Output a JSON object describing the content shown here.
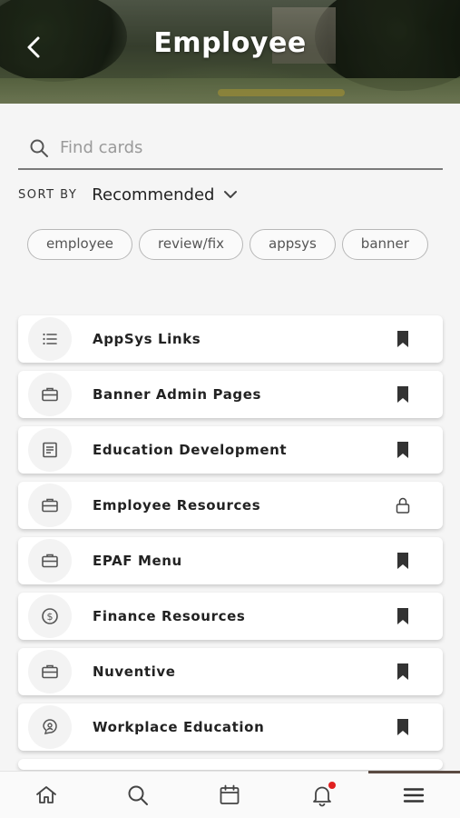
{
  "header": {
    "title": "Employee",
    "back_icon": "chevron-left-icon"
  },
  "search": {
    "placeholder": "Find cards",
    "value": "",
    "icon": "search-icon"
  },
  "sort": {
    "label": "SORT BY",
    "value": "Recommended",
    "icon": "chevron-down-icon"
  },
  "tags": [
    "employee",
    "review/fix",
    "appsys",
    "banner"
  ],
  "cards": [
    {
      "title": "AppSys Links",
      "icon": "list-icon",
      "action": "bookmark-icon"
    },
    {
      "title": "Banner Admin Pages",
      "icon": "briefcase-icon",
      "action": "bookmark-icon"
    },
    {
      "title": "Education Development",
      "icon": "document-icon",
      "action": "bookmark-icon"
    },
    {
      "title": "Employee Resources",
      "icon": "briefcase-icon",
      "action": "lock-icon"
    },
    {
      "title": "EPAF Menu",
      "icon": "briefcase-icon",
      "action": "bookmark-icon"
    },
    {
      "title": "Finance Resources",
      "icon": "dollar-circle-icon",
      "action": "bookmark-icon"
    },
    {
      "title": "Nuventive",
      "icon": "briefcase-icon",
      "action": "bookmark-icon"
    },
    {
      "title": "Workplace Education",
      "icon": "chat-person-icon",
      "action": "bookmark-icon"
    }
  ],
  "bottom_nav": [
    {
      "name": "home",
      "icon": "home-icon"
    },
    {
      "name": "search",
      "icon": "search-icon"
    },
    {
      "name": "calendar",
      "icon": "calendar-icon"
    },
    {
      "name": "notifications",
      "icon": "bell-icon"
    },
    {
      "name": "menu",
      "icon": "menu-icon",
      "active": true
    }
  ],
  "colors": {
    "accent": "#5a4a42",
    "notification_dot": "#e02020",
    "background": "#f5f5f5"
  }
}
